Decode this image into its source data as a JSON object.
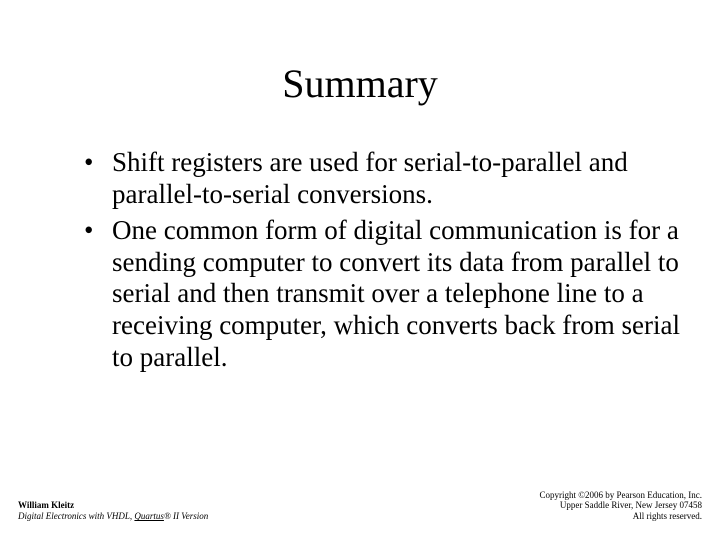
{
  "title": "Summary",
  "bullets": [
    "Shift registers are used for serial-to-parallel and parallel-to-serial conversions.",
    "One common form of digital communication is for a sending computer to convert its data from parallel to serial and then transmit over a telephone line to a receiving computer, which converts back from serial to parallel."
  ],
  "footer": {
    "author": "William Kleitz",
    "book_prefix": "Digital Electronics with VHDL, ",
    "book_quartus": "Quartus",
    "book_suffix": "® II Version",
    "copyright_line1": "Copyright ©2006 by Pearson Education, Inc.",
    "copyright_line2": "Upper Saddle River, New Jersey 07458",
    "copyright_line3": "All rights reserved."
  }
}
